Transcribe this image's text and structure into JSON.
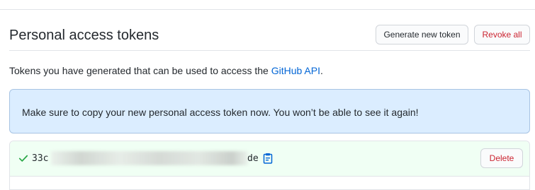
{
  "header": {
    "title": "Personal access tokens",
    "generate_label": "Generate new token",
    "revoke_label": "Revoke all"
  },
  "description": {
    "prefix": "Tokens you have generated that can be used to access the ",
    "link_text": "GitHub API",
    "suffix": "."
  },
  "flash": {
    "message": "Make sure to copy your new personal access token now. You won’t be able to see it again!"
  },
  "token": {
    "visible_start": "33c",
    "visible_end": "de",
    "delete_label": "Delete",
    "check_icon": "check-icon",
    "copy_icon": "clipboard-icon"
  },
  "colors": {
    "link": "#0366d6",
    "danger": "#cb2431",
    "flash_bg": "#dbedff",
    "success_bg": "#f0fff4",
    "check": "#28a745"
  }
}
